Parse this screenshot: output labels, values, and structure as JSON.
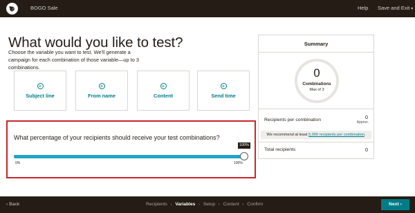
{
  "topbar": {
    "campaign_title": "BOGO Sale",
    "help_label": "Help",
    "save_exit_label": "Save and Exit",
    "save_exit_caret": "▾"
  },
  "main": {
    "title": "What would you like to test?",
    "subtitle": "Choose the variable you want to test. We'll generate a campaign for each combination of those variable—up to 3 combinations.",
    "variables": [
      {
        "label": "Subject line",
        "icon": "plus-circle-icon"
      },
      {
        "label": "From name",
        "icon": "plus-circle-icon"
      },
      {
        "label": "Content",
        "icon": "plus-circle-icon"
      },
      {
        "label": "Send time",
        "icon": "plus-circle-icon"
      }
    ]
  },
  "percentage": {
    "question": "What percentage of your recipients should receive your test combinations?",
    "value_pct": 100,
    "tooltip": "100%",
    "min_label": "0%",
    "max_label": "100%"
  },
  "summary": {
    "title": "Summary",
    "combinations_count": "0",
    "combinations_label": "Combinations",
    "max_label": "Max of 3",
    "recipients_per_combination_label": "Recipients per combination",
    "recipients_per_combination_value": "0",
    "recipients_per_combination_sub": "Approx.",
    "recommend_prefix": "We recommend at least ",
    "recommend_link": "5,000 recipients per combination",
    "recommend_suffix": ".",
    "total_recipients_label": "Total recipients",
    "total_recipients_value": "0"
  },
  "bottombar": {
    "back_label": "‹ Back",
    "steps": [
      {
        "label": "Recipients",
        "active": false
      },
      {
        "label": "Variables",
        "active": true
      },
      {
        "label": "Setup",
        "active": false
      },
      {
        "label": "Content",
        "active": false
      },
      {
        "label": "Confirm",
        "active": false
      }
    ],
    "step_separator": "›",
    "next_label": "Next ›"
  },
  "colors": {
    "accent": "#007c89",
    "slider": "#1fa6c6",
    "highlight_border": "#c8242a",
    "bar_bg": "#241c15"
  }
}
